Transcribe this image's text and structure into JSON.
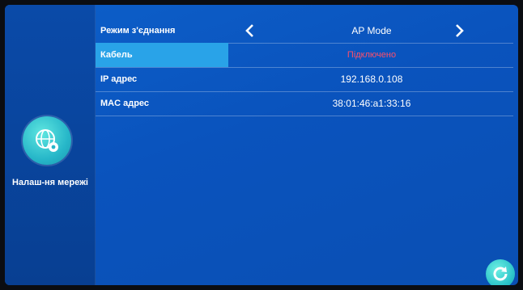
{
  "sidebar": {
    "network_label": "Налаш-ня мережі",
    "network_icon": "globe-settings-icon"
  },
  "settings": {
    "rows": [
      {
        "label": "Режим з'єднання",
        "value": "AP Mode"
      },
      {
        "label": "Кабель",
        "value": "Підключено"
      },
      {
        "label": "IP адрес",
        "value": "192.168.0.108"
      },
      {
        "label": "MAC адрес",
        "value": "38:01:46:a1:33:16"
      }
    ]
  },
  "icons": {
    "prev": "chevron-left-icon",
    "next": "chevron-right-icon",
    "refresh": "refresh-icon"
  },
  "colors": {
    "background": "#0a53bd",
    "highlight": "#29a3e8",
    "status_red": "#ff4f6a",
    "accent": "#2bc3c9"
  }
}
